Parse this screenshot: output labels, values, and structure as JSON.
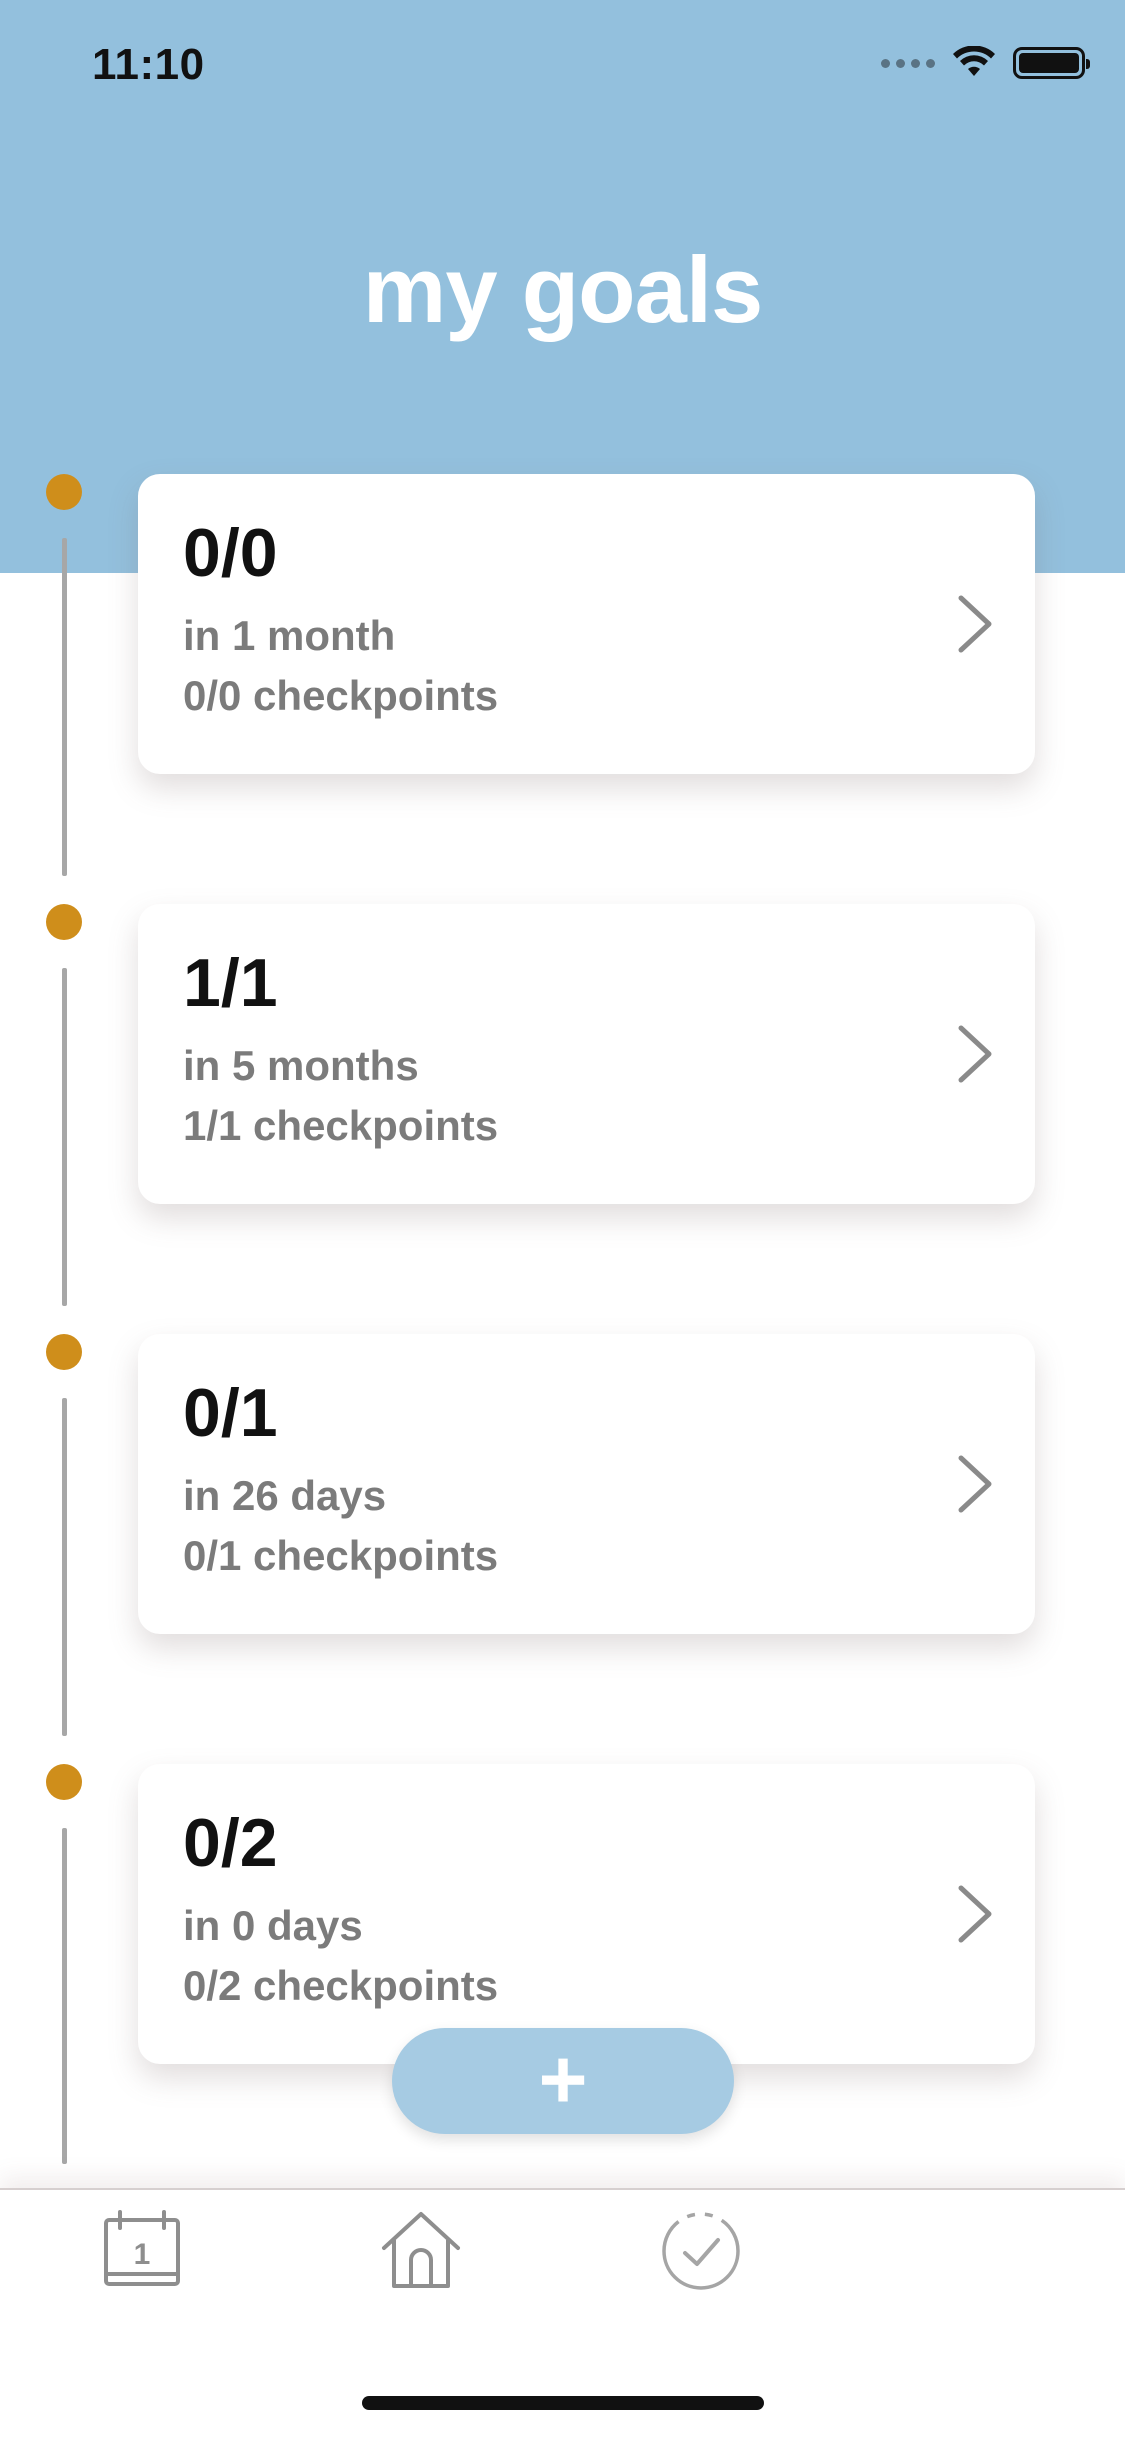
{
  "status_bar": {
    "time": "11:10"
  },
  "header": {
    "title": "my goals"
  },
  "goals": [
    {
      "title": "0/0",
      "due": "in 1 month",
      "checkpoints": "0/0 checkpoints"
    },
    {
      "title": "1/1",
      "due": "in 5 months",
      "checkpoints": "1/1 checkpoints"
    },
    {
      "title": "0/1",
      "due": "in 26 days",
      "checkpoints": "0/1 checkpoints"
    },
    {
      "title": "0/2",
      "due": "in 0 days",
      "checkpoints": "0/2 checkpoints"
    }
  ],
  "add_button": {
    "label": "+"
  },
  "tab_bar": {
    "tabs": [
      {
        "icon": "calendar-icon",
        "day": "1"
      },
      {
        "icon": "home-icon"
      },
      {
        "icon": "checkmark-circle-icon"
      }
    ]
  },
  "colors": {
    "header_bg": "#93c0dd",
    "timeline_dot": "#cf8e1b",
    "add_button_bg": "#a6cbe3"
  }
}
